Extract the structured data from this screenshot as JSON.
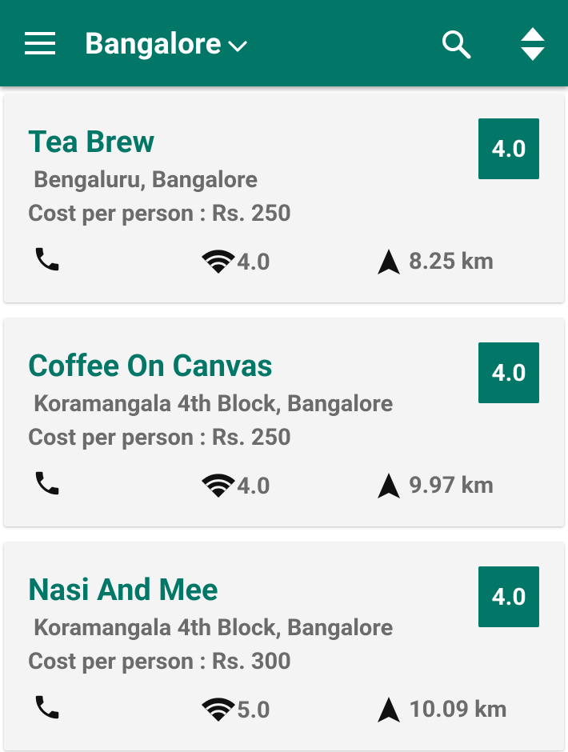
{
  "appbar": {
    "city": "Bangalore",
    "accent_color": "#027767",
    "icons": [
      "menu-icon",
      "chevron-down-icon",
      "search-icon",
      "sort-icon"
    ]
  },
  "restaurants": [
    {
      "name": "Tea Brew",
      "location": "Bengaluru, Bangalore",
      "cost": "Cost per person : Rs. 250",
      "rating": "4.0",
      "wifi_rating": "4.0",
      "distance": "8.25 km"
    },
    {
      "name": "Coffee On Canvas",
      "location": "Koramangala 4th Block, Bangalore",
      "cost": "Cost per person : Rs. 250",
      "rating": "4.0",
      "wifi_rating": "4.0",
      "distance": "9.97 km"
    },
    {
      "name": "Nasi And Mee",
      "location": "Koramangala 4th Block, Bangalore",
      "cost": "Cost per person : Rs. 300",
      "rating": "4.0",
      "wifi_rating": "5.0",
      "distance": "10.09 km"
    }
  ]
}
